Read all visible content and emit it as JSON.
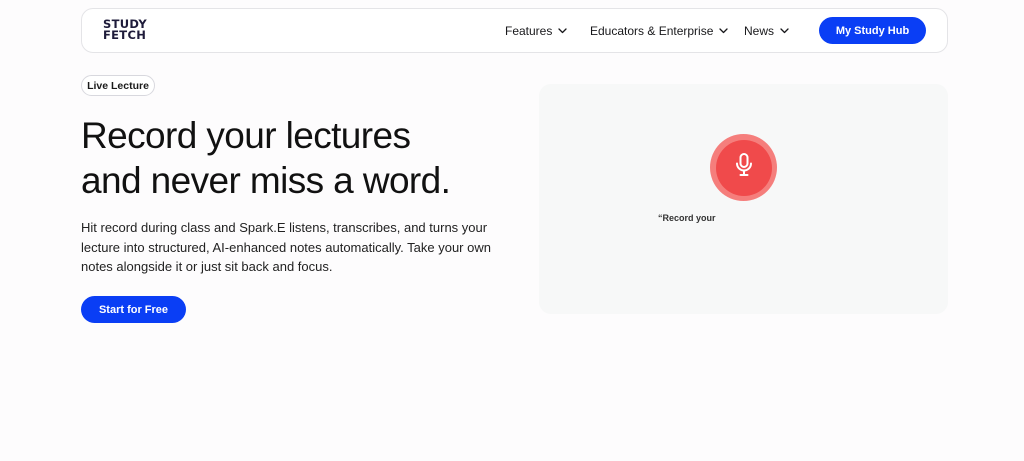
{
  "navbar": {
    "logo_line1": "STUDY",
    "logo_line2": "FETCH",
    "items": [
      {
        "label": "Features"
      },
      {
        "label": "Educators & Enterprise"
      },
      {
        "label": "News"
      }
    ],
    "cta_label": "My Study Hub"
  },
  "hero": {
    "badge": "Live Lecture",
    "headline_line1": "Record your lectures",
    "headline_line2": "and never miss a word.",
    "description": "Hit record during class and Spark.E listens, transcribes, and turns your lecture into structured, AI-enhanced notes automatically. Take your own notes alongside it or just sit back and focus.",
    "cta_label": "Start for Free"
  },
  "demo": {
    "mic_icon": "microphone-icon",
    "transcript_text": "“Record your"
  },
  "colors": {
    "brand_blue": "#0a3ef5",
    "mic_red": "#f04a4b",
    "mic_ring": "#f57e7c",
    "panel_bg": "#f7f8f8"
  }
}
